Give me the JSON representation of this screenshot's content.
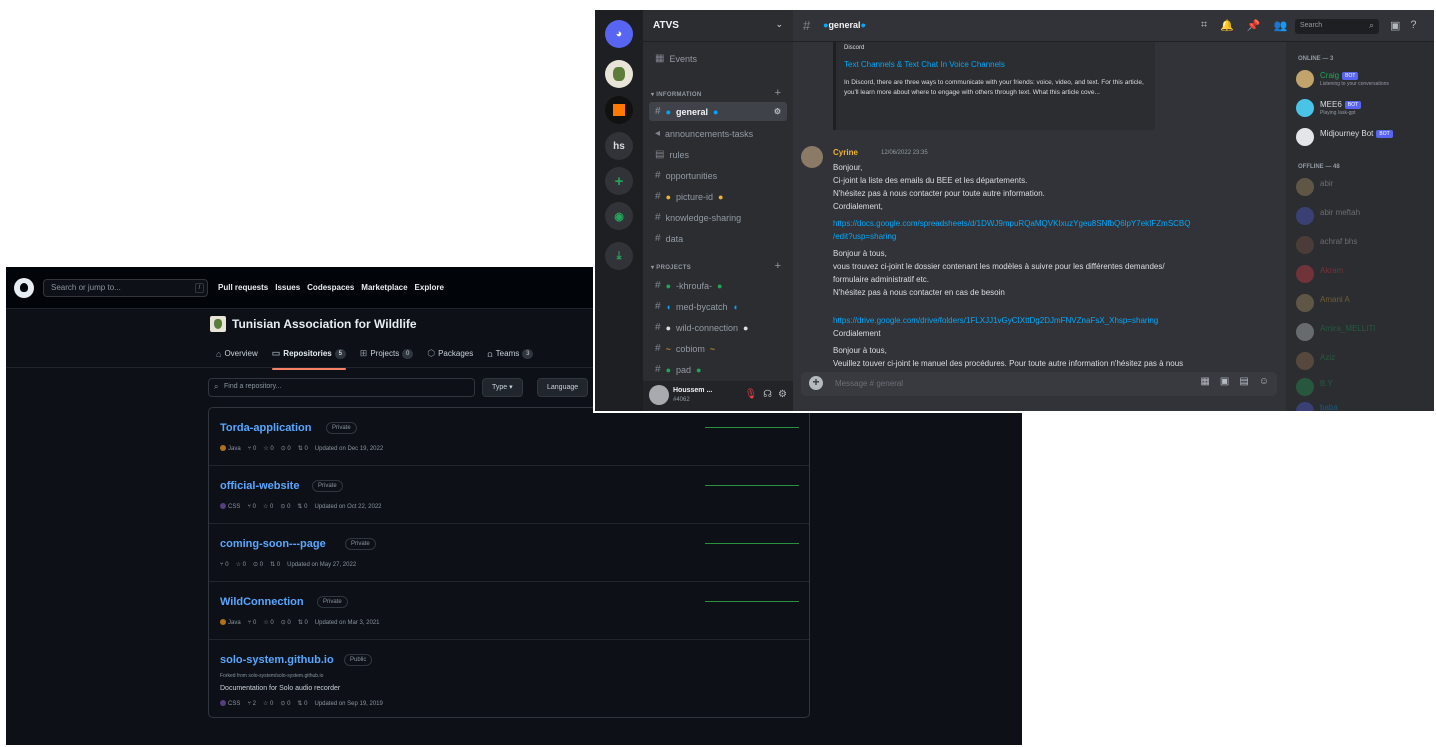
{
  "github": {
    "search_placeholder": "Search or jump to...",
    "search_key": "/",
    "nav": [
      "Pull requests",
      "Issues",
      "Codespaces",
      "Marketplace",
      "Explore"
    ],
    "org_name": "Tunisian Association for Wildlife",
    "tabs": [
      {
        "label": "Overview",
        "icon": "home-icon",
        "count": ""
      },
      {
        "label": "Repositories",
        "icon": "repo-icon",
        "count": "5"
      },
      {
        "label": "Projects",
        "icon": "table-icon",
        "count": "0"
      },
      {
        "label": "Packages",
        "icon": "package-icon",
        "count": ""
      },
      {
        "label": "Teams",
        "icon": "people-icon",
        "count": "3"
      }
    ],
    "find_placeholder": "Find a repository...",
    "type_button": "Type ▾",
    "language_button": "Language",
    "repos": [
      {
        "name": "Torda-application",
        "visibility": "Private",
        "language": "Java",
        "lang_color": "#b07219",
        "forks": "0",
        "stars": "0",
        "issues": "0",
        "prs": "0",
        "updated": "Updated on Dec 19, 2022",
        "fork_note": "",
        "description": ""
      },
      {
        "name": "official-website",
        "visibility": "Private",
        "language": "CSS",
        "lang_color": "#563d7c",
        "forks": "0",
        "stars": "0",
        "issues": "0",
        "prs": "0",
        "updated": "Updated on Oct 22, 2022",
        "fork_note": "",
        "description": ""
      },
      {
        "name": "coming-soon---page",
        "visibility": "Private",
        "language": "",
        "lang_color": "",
        "forks": "0",
        "stars": "0",
        "issues": "0",
        "prs": "0",
        "updated": "Updated on May 27, 2022",
        "fork_note": "",
        "description": ""
      },
      {
        "name": "WildConnection",
        "visibility": "Private",
        "language": "Java",
        "lang_color": "#b07219",
        "forks": "0",
        "stars": "0",
        "issues": "0",
        "prs": "0",
        "updated": "Updated on Mar 3, 2021",
        "fork_note": "",
        "description": ""
      },
      {
        "name": "solo-system.github.io",
        "visibility": "Public",
        "language": "CSS",
        "lang_color": "#563d7c",
        "forks": "2",
        "stars": "0",
        "issues": "0",
        "prs": "0",
        "updated": "Updated on Sep 19, 2019",
        "fork_note": "Forked from solo-system/solo-system.github.io",
        "description": "Documentation for Solo audio recorder"
      }
    ]
  },
  "discord": {
    "server_name": "ATVS",
    "servers": [
      "hs",
      "+"
    ],
    "events_label": "Events",
    "categories": {
      "information": "INFORMATION",
      "projects": "PROJECTS"
    },
    "channels_info": [
      {
        "label": "general",
        "icon": "hash-icon",
        "selected": true
      },
      {
        "label": "announcements-tasks",
        "icon": "megaphone-icon",
        "selected": false
      },
      {
        "label": "rules",
        "icon": "rules-icon",
        "selected": false
      },
      {
        "label": "opportunities",
        "icon": "hash-icon",
        "selected": false
      },
      {
        "label": "picture-id",
        "icon": "hash-icon",
        "selected": false
      },
      {
        "label": "knowledge-sharing",
        "icon": "hash-icon",
        "selected": false
      },
      {
        "label": "data",
        "icon": "hash-icon",
        "selected": false
      }
    ],
    "channels_projects": [
      {
        "label": "-khroufa-",
        "icon": "hash-icon"
      },
      {
        "label": "med-bycatch",
        "icon": "hash-icon"
      },
      {
        "label": "wild-connection",
        "icon": "hash-icon"
      },
      {
        "label": "cobiom",
        "icon": "hash-icon"
      },
      {
        "label": "pad",
        "icon": "hash-icon"
      }
    ],
    "user": {
      "name": "Houssem ...",
      "tag": "#4062"
    },
    "header_channel": "general",
    "search_placeholder": "Search",
    "embed": {
      "provider": "Discord",
      "title": "Text Channels & Text Chat In Voice Channels",
      "body": "In Discord, there are three ways to communicate with your friends: voice, video, and text. For this article, you'll learn more about where to engage with others through text. What this article cove..."
    },
    "message": {
      "author": "Cyrine",
      "time": "12/06/2022 23:35",
      "lines": [
        "Bonjour,",
        "Ci-joint la liste des emails du BEE et les départements.",
        "N'hésitez pas à nous contacter pour toute autre information.",
        "Cordialement,",
        "https://docs.google.com/spreadsheets/d/1DWJ9mpuRQaMQVKIxuzYgeu8SNfbQ6lpY7ekIFZmSCBQ",
        "/edit?usp=sharing",
        "Bonjour à tous,",
        "vous trouvez ci-joint le dossier contenant les modèles à suivre pour les différentes demandes/",
        "formulaire administratif etc.",
        "N'hésitez pas à nous contacter en cas de besoin",
        "https://drive.google.com/drive/folders/1FLXJJ1vGyCIXttDg2DJmFNVZnaFsX_Xhsp=sharing",
        " Cordialement",
        "Bonjour à tous,",
        "Veuillez touver ci-joint le manuel des procédures. Pour toute autre information n'hésitez pas à nous"
      ]
    },
    "input_placeholder": "Message # general",
    "members": {
      "online_label": "ONLINE — 3",
      "offline_label": "OFFLINE — 48",
      "online": [
        {
          "name": "Craig",
          "status": "Listening to your conversations",
          "bot": "BOT",
          "color": "#23a559"
        },
        {
          "name": "MEE6",
          "status": "Playing /ask-gpt",
          "bot": "BOT",
          "color": "#dbdee1"
        },
        {
          "name": "Midjourney Bot",
          "status": "",
          "bot": "BOT",
          "color": "#dbdee1"
        }
      ],
      "offline": [
        "abir",
        "abir meftah",
        "achraf bhs",
        "Akram",
        "Amani A",
        "Amira_MELLITI",
        "Aziz",
        "B.Y",
        "baba"
      ]
    }
  }
}
